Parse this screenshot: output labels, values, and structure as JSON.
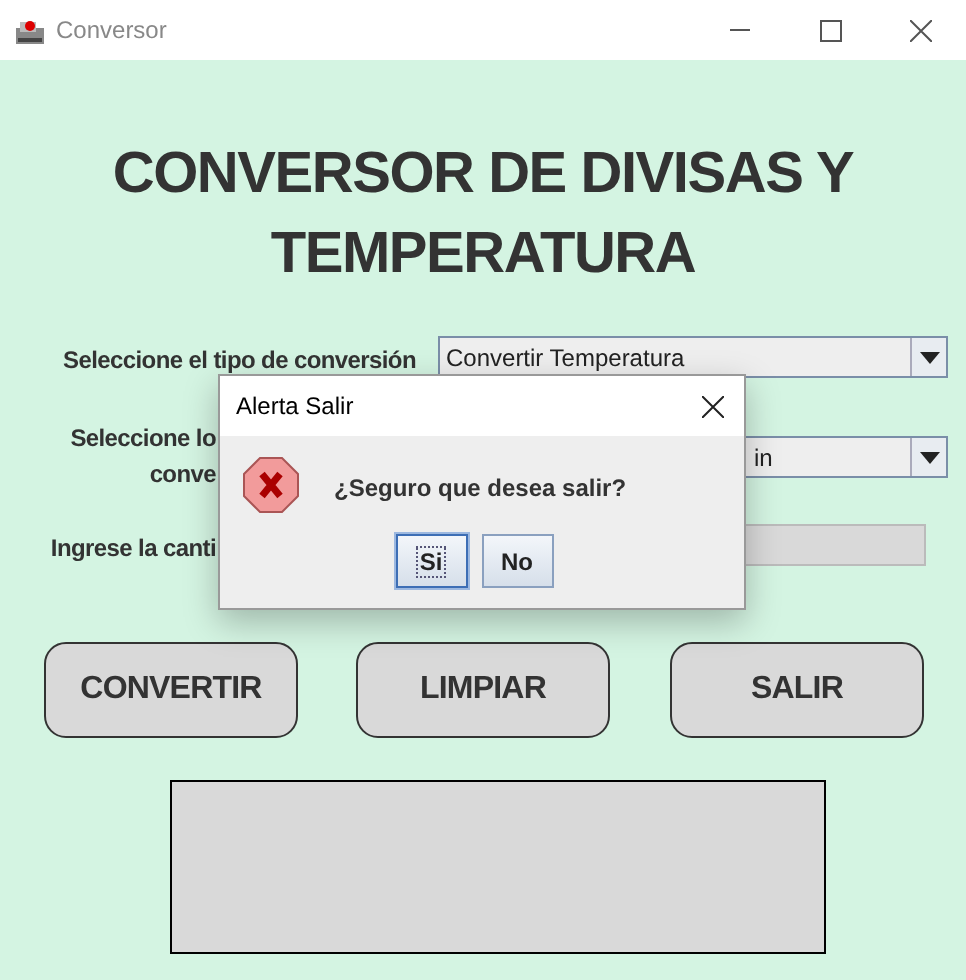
{
  "window": {
    "title": "Conversor"
  },
  "heading": "CONVERSOR DE DIVISAS Y TEMPERATURA",
  "rows": [
    {
      "kind": "dropdown",
      "label": [
        "Seleccione el tipo de conversión"
      ],
      "value": "Convertir Temperatura"
    },
    {
      "kind": "dropdown",
      "label": [
        "Seleccione lo",
        "conve"
      ],
      "value": "in"
    },
    {
      "kind": "field",
      "label": [
        "Ingrese la canti"
      ]
    }
  ],
  "buttons": [
    "CONVERTIR",
    "LIMPIAR",
    "SALIR"
  ],
  "dialog": {
    "title": "Alerta Salir",
    "message": "¿Seguro que desea salir?",
    "buttons": [
      {
        "label": "Si",
        "focused": true
      },
      {
        "label": "No",
        "focused": false
      }
    ]
  }
}
